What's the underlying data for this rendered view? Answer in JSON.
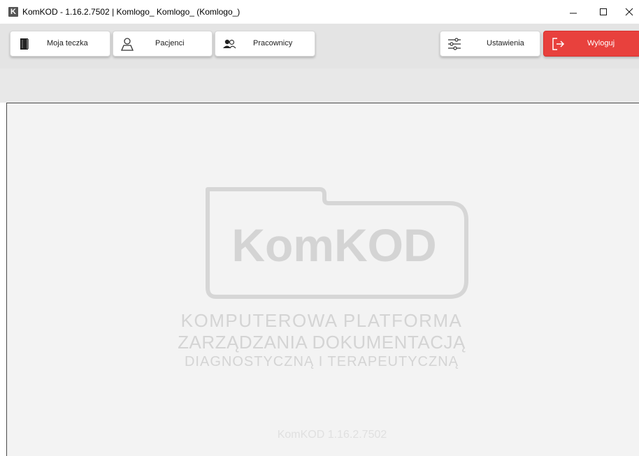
{
  "window": {
    "app_icon_letter": "K",
    "title": "KomKOD - 1.16.2.7502 | Komlogo_ Komlogo_ (Komlogo_)"
  },
  "toolbar": {
    "left_buttons": [
      {
        "label": "Moja teczka",
        "icon": "folder-icon"
      },
      {
        "label": "Pacjenci",
        "icon": "person-icon"
      },
      {
        "label": "Pracownicy",
        "icon": "people-icon"
      }
    ],
    "right_buttons": [
      {
        "label": "Ustawienia",
        "icon": "sliders-icon"
      },
      {
        "label": "Wyloguj",
        "icon": "logout-icon"
      }
    ]
  },
  "content": {
    "logo_text": "KomKOD",
    "subtitle_line1": "KOMPUTEROWA  PLATFORMA",
    "subtitle_line2": "ZARZĄDZANIA DOKUMENTACJĄ",
    "subtitle_line3": "DIAGNOSTYCZNĄ  I  TERAPEUTYCZNĄ",
    "version": "KomKOD  1.16.2.7502"
  },
  "colors": {
    "logout_accent": "#e8413d",
    "watermark": "#d4d4d4",
    "toolbar_bg": "#e4e4e4"
  }
}
